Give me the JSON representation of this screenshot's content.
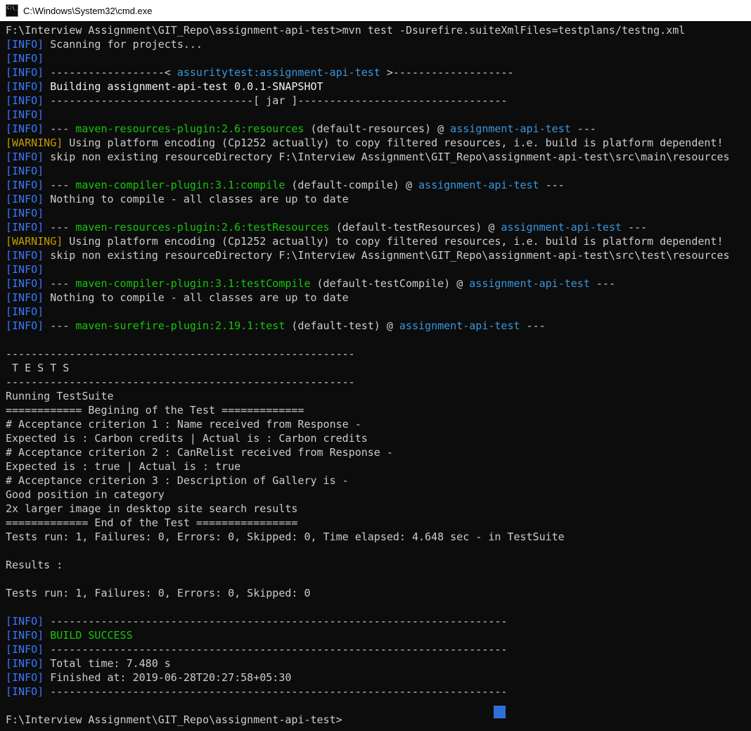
{
  "window": {
    "title": "C:\\Windows\\System32\\cmd.exe"
  },
  "colors": {
    "background": "#0C0C0C",
    "default": "#CCCCCC",
    "bright": "#F2F2F2",
    "info": "#3B78FF",
    "warning": "#C19C00",
    "green": "#16C60C",
    "cyan": "#3A96DD",
    "titlebar_bg": "#FFFFFF",
    "titlebar_text": "#000000",
    "artifact_blue": "#2F6FD8"
  },
  "terminal": {
    "lines": [
      [
        [
          "F:\\Interview Assignment\\GIT_Repo\\assignment-api-test>mvn test -Dsurefire.suiteXmlFiles=testplans/testng.xml",
          "default"
        ]
      ],
      [
        [
          "[INFO]",
          "info"
        ],
        [
          " Scanning for projects...",
          "default"
        ]
      ],
      [
        [
          "[INFO]",
          "info"
        ]
      ],
      [
        [
          "[INFO]",
          "info"
        ],
        [
          " ------------------< ",
          "default"
        ],
        [
          "assuritytest:assignment-api-test",
          "cyan"
        ],
        [
          " >-------------------",
          "default"
        ]
      ],
      [
        [
          "[INFO]",
          "info"
        ],
        [
          " ",
          "default"
        ],
        [
          "Building assignment-api-test 0.0.1-SNAPSHOT",
          "bright"
        ]
      ],
      [
        [
          "[INFO]",
          "info"
        ],
        [
          " --------------------------------[ jar ]---------------------------------",
          "default"
        ]
      ],
      [
        [
          "[INFO]",
          "info"
        ]
      ],
      [
        [
          "[INFO]",
          "info"
        ],
        [
          " --- ",
          "default"
        ],
        [
          "maven-resources-plugin:2.6:resources",
          "green"
        ],
        [
          " (default-resources) @ ",
          "default"
        ],
        [
          "assignment-api-test",
          "cyan"
        ],
        [
          " ---",
          "default"
        ]
      ],
      [
        [
          "[WARNING]",
          "warning"
        ],
        [
          " Using platform encoding (Cp1252 actually) to copy filtered resources, i.e. build is platform dependent!",
          "default"
        ]
      ],
      [
        [
          "[INFO]",
          "info"
        ],
        [
          " skip non existing resourceDirectory F:\\Interview Assignment\\GIT_Repo\\assignment-api-test\\src\\main\\resources",
          "default"
        ]
      ],
      [
        [
          "[INFO]",
          "info"
        ]
      ],
      [
        [
          "[INFO]",
          "info"
        ],
        [
          " --- ",
          "default"
        ],
        [
          "maven-compiler-plugin:3.1:compile",
          "green"
        ],
        [
          " (default-compile) @ ",
          "default"
        ],
        [
          "assignment-api-test",
          "cyan"
        ],
        [
          " ---",
          "default"
        ]
      ],
      [
        [
          "[INFO]",
          "info"
        ],
        [
          " Nothing to compile - all classes are up to date",
          "default"
        ]
      ],
      [
        [
          "[INFO]",
          "info"
        ]
      ],
      [
        [
          "[INFO]",
          "info"
        ],
        [
          " --- ",
          "default"
        ],
        [
          "maven-resources-plugin:2.6:testResources",
          "green"
        ],
        [
          " (default-testResources) @ ",
          "default"
        ],
        [
          "assignment-api-test",
          "cyan"
        ],
        [
          " ---",
          "default"
        ]
      ],
      [
        [
          "[WARNING]",
          "warning"
        ],
        [
          " Using platform encoding (Cp1252 actually) to copy filtered resources, i.e. build is platform dependent!",
          "default"
        ]
      ],
      [
        [
          "[INFO]",
          "info"
        ],
        [
          " skip non existing resourceDirectory F:\\Interview Assignment\\GIT_Repo\\assignment-api-test\\src\\test\\resources",
          "default"
        ]
      ],
      [
        [
          "[INFO]",
          "info"
        ]
      ],
      [
        [
          "[INFO]",
          "info"
        ],
        [
          " --- ",
          "default"
        ],
        [
          "maven-compiler-plugin:3.1:testCompile",
          "green"
        ],
        [
          " (default-testCompile) @ ",
          "default"
        ],
        [
          "assignment-api-test",
          "cyan"
        ],
        [
          " ---",
          "default"
        ]
      ],
      [
        [
          "[INFO]",
          "info"
        ],
        [
          " Nothing to compile - all classes are up to date",
          "default"
        ]
      ],
      [
        [
          "[INFO]",
          "info"
        ]
      ],
      [
        [
          "[INFO]",
          "info"
        ],
        [
          " --- ",
          "default"
        ],
        [
          "maven-surefire-plugin:2.19.1:test",
          "green"
        ],
        [
          " (default-test) @ ",
          "default"
        ],
        [
          "assignment-api-test",
          "cyan"
        ],
        [
          " ---",
          "default"
        ]
      ],
      [],
      [
        [
          "-------------------------------------------------------",
          "default"
        ]
      ],
      [
        [
          " T E S T S",
          "default"
        ]
      ],
      [
        [
          "-------------------------------------------------------",
          "default"
        ]
      ],
      [
        [
          "Running TestSuite",
          "default"
        ]
      ],
      [
        [
          "============ Begining of the Test =============",
          "default"
        ]
      ],
      [
        [
          "# Acceptance criterion 1 : Name received from Response -",
          "default"
        ]
      ],
      [
        [
          "Expected is : Carbon credits | Actual is : Carbon credits",
          "default"
        ]
      ],
      [
        [
          "# Acceptance criterion 2 : CanRelist received from Response -",
          "default"
        ]
      ],
      [
        [
          "Expected is : true | Actual is : true",
          "default"
        ]
      ],
      [
        [
          "# Acceptance criterion 3 : Description of Gallery is -",
          "default"
        ]
      ],
      [
        [
          "Good position in category",
          "default"
        ]
      ],
      [
        [
          "2x larger image in desktop site search results",
          "default"
        ]
      ],
      [
        [
          "============= End of the Test ================",
          "default"
        ]
      ],
      [
        [
          "Tests run: 1, Failures: 0, Errors: 0, Skipped: 0, Time elapsed: 4.648 sec - in TestSuite",
          "default"
        ]
      ],
      [],
      [
        [
          "Results :",
          "default"
        ]
      ],
      [],
      [
        [
          "Tests run: 1, Failures: 0, Errors: 0, Skipped: 0",
          "default"
        ]
      ],
      [],
      [
        [
          "[INFO]",
          "info"
        ],
        [
          " ------------------------------------------------------------------------",
          "default"
        ]
      ],
      [
        [
          "[INFO]",
          "info"
        ],
        [
          " ",
          "default"
        ],
        [
          "BUILD SUCCESS",
          "green"
        ]
      ],
      [
        [
          "[INFO]",
          "info"
        ],
        [
          " ------------------------------------------------------------------------",
          "default"
        ]
      ],
      [
        [
          "[INFO]",
          "info"
        ],
        [
          " Total time: 7.480 s",
          "default"
        ]
      ],
      [
        [
          "[INFO]",
          "info"
        ],
        [
          " Finished at: 2019-06-28T20:27:58+05:30",
          "default"
        ]
      ],
      [
        [
          "[INFO]",
          "info"
        ],
        [
          " ------------------------------------------------------------------------",
          "default"
        ]
      ],
      [],
      [
        [
          "F:\\Interview Assignment\\GIT_Repo\\assignment-api-test>",
          "default"
        ]
      ]
    ]
  }
}
